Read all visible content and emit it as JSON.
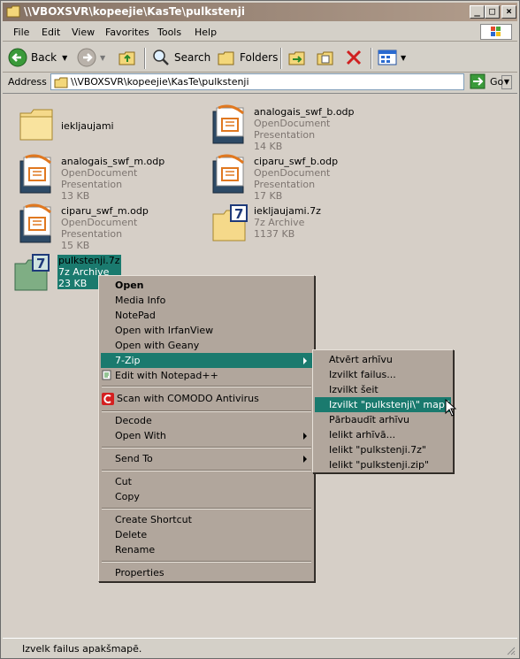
{
  "window": {
    "title": "\\\\VBOXSVR\\kopeejie\\KasTe\\pulkstenji",
    "minimize": "_",
    "maximize": "□",
    "close": "×"
  },
  "menubar": {
    "items": [
      "File",
      "Edit",
      "View",
      "Favorites",
      "Tools",
      "Help"
    ]
  },
  "toolbar": {
    "back": "Back",
    "search": "Search",
    "folders": "Folders"
  },
  "address": {
    "label": "Address",
    "value": "\\\\VBOXSVR\\kopeejie\\KasTe\\pulkstenji",
    "go": "Go"
  },
  "files": [
    {
      "name": "iekljaujami",
      "type": "",
      "size": ""
    },
    {
      "name": "analogais_swf_b.odp",
      "type": "OpenDocument Presentation",
      "size": "14 KB"
    },
    {
      "name": "analogais_swf_m.odp",
      "type": "OpenDocument Presentation",
      "size": "13 KB"
    },
    {
      "name": "ciparu_swf_b.odp",
      "type": "OpenDocument Presentation",
      "size": "17 KB"
    },
    {
      "name": "ciparu_swf_m.odp",
      "type": "OpenDocument Presentation",
      "size": "15 KB"
    },
    {
      "name": "iekljaujami.7z",
      "type": "7z Archive",
      "size": "1137 KB"
    },
    {
      "name": "pulkstenji.7z",
      "type": "7z Archive",
      "size": "23 KB"
    }
  ],
  "context_menu": {
    "open": "Open",
    "media_info": "Media Info",
    "notepad": "NotePad",
    "irfanview": "Open with IrfanView",
    "geany": "Open with Geany",
    "sevenzip": "7-Zip",
    "notepadpp": "Edit with Notepad++",
    "comodo": "Scan with COMODO Antivirus",
    "decode": "Decode",
    "open_with": "Open With",
    "send_to": "Send To",
    "cut": "Cut",
    "copy": "Copy",
    "create_shortcut": "Create Shortcut",
    "delete": "Delete",
    "rename": "Rename",
    "properties": "Properties"
  },
  "submenu": {
    "items": [
      "Atvērt arhīvu",
      "Izvilkt failus...",
      "Izvilkt šeit",
      "Izvilkt \"pulkstenji\\\" mapē",
      "Pārbaudīt arhīvu",
      "Ielikt arhīvā...",
      "Ielikt \"pulkstenji.7z\"",
      "Ielikt \"pulkstenji.zip\""
    ],
    "highlighted_index": 3
  },
  "status": {
    "text": "Izvelk failus apakšmapē."
  },
  "colors": {
    "selection": "#1a7a6e",
    "title_gradient_start": "#857265",
    "menu_bg": "#b1a69c"
  }
}
